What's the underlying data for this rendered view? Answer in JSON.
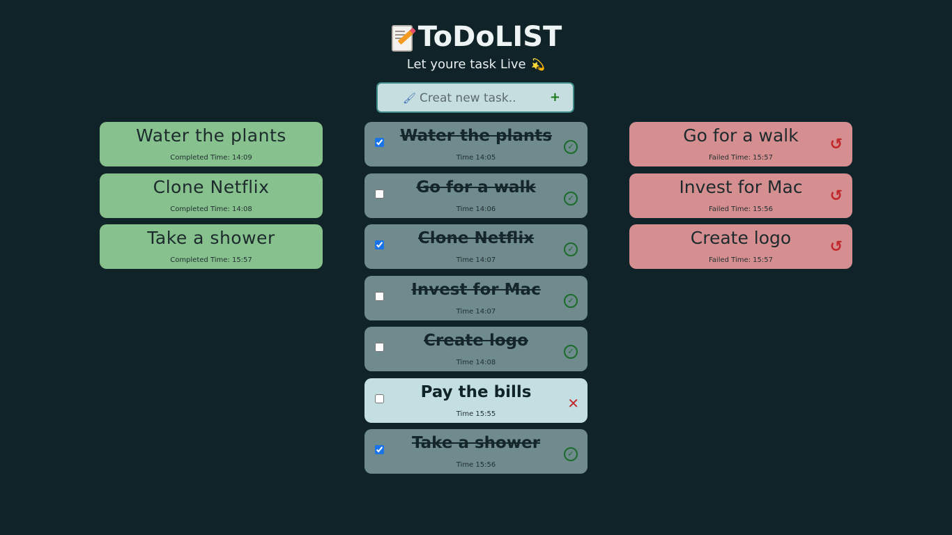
{
  "header": {
    "title": "ToDoLIST",
    "subtitle": "Let youre task Live",
    "title_icon": "memo-icon",
    "subtitle_icon": "dizzy-comet-icon"
  },
  "new_task": {
    "placeholder": "Creat new task..",
    "add_label": "+",
    "icon": "paintbrush-icon"
  },
  "completed": [
    {
      "name": "Water the plants",
      "time": "Completed Time: 14:09"
    },
    {
      "name": "Clone Netflix",
      "time": "Completed Time: 14:08"
    },
    {
      "name": "Take a shower",
      "time": "Completed Time: 15:57"
    }
  ],
  "tasks": [
    {
      "name": "Water the plants",
      "time": "Time 14:05",
      "checked": true,
      "status": "done"
    },
    {
      "name": "Go for a walk",
      "time": "Time 14:06",
      "checked": false,
      "status": "done"
    },
    {
      "name": "Clone Netflix",
      "time": "Time 14:07",
      "checked": true,
      "status": "done"
    },
    {
      "name": "Invest for Mac",
      "time": "Time 14:07",
      "checked": false,
      "status": "done"
    },
    {
      "name": "Create logo",
      "time": "Time 14:08",
      "checked": false,
      "status": "done"
    },
    {
      "name": "Pay the bills",
      "time": "Time 15:55",
      "checked": false,
      "status": "active"
    },
    {
      "name": "Take a shower",
      "time": "Time 15:56",
      "checked": true,
      "status": "done"
    }
  ],
  "failed": [
    {
      "name": "Go for a walk",
      "time": "Failed Time: 15:57"
    },
    {
      "name": "Invest for Mac",
      "time": "Failed Time: 15:56"
    },
    {
      "name": "Create logo",
      "time": "Failed Time: 15:57"
    }
  ],
  "colors": {
    "background": "#102328",
    "completed": "#87c18e",
    "failed": "#d68f90",
    "task_done": "#6f8b8d",
    "task_active": "#c4dfe1"
  }
}
